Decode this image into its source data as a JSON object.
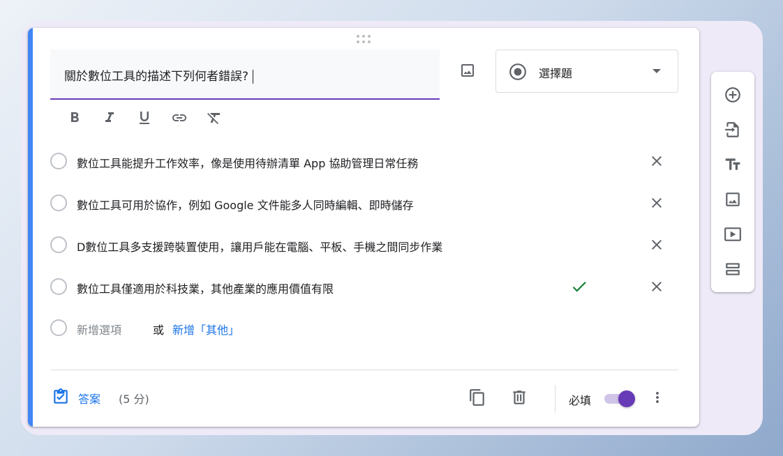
{
  "question": {
    "title": "關於數位工具的描述下列何者錯誤?",
    "type_label": "選擇題"
  },
  "format_toolbar": {
    "bold_icon": "bold-icon",
    "italic_icon": "italic-icon",
    "underline_icon": "underline-icon",
    "link_icon": "link-icon",
    "clear_format_icon": "clear-format-icon"
  },
  "options": [
    {
      "text": "數位工具能提升工作效率，像是使用待辦清單 App 協助管理日常任務",
      "correct": false
    },
    {
      "text": "數位工具可用於協作，例如 Google 文件能多人同時編輯、即時儲存",
      "correct": false
    },
    {
      "text": "D數位工具多支援跨裝置使用，讓用戶能在電腦、平板、手機之間同步作業",
      "correct": false
    },
    {
      "text": "數位工具僅適用於科技業，其他產業的應用價值有限",
      "correct": true
    }
  ],
  "add_option": {
    "label": "新增選項",
    "or": "或",
    "add_other": "新增「其他」"
  },
  "footer": {
    "answer_label": "答案",
    "points": "(5 分)",
    "required_label": "必填",
    "required_on": true
  },
  "colors": {
    "accent_blue": "#4285f4",
    "purple": "#673ab7",
    "link_blue": "#1a73e8",
    "check_green": "#188038"
  }
}
